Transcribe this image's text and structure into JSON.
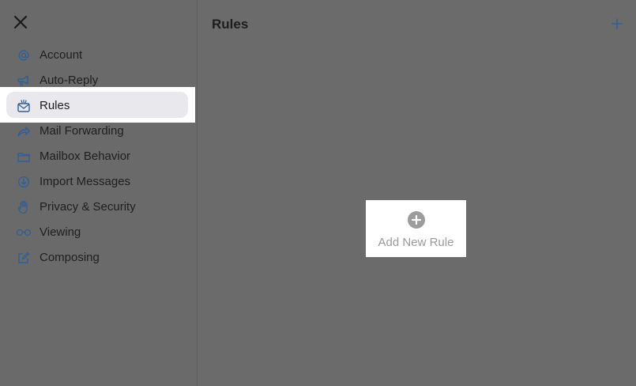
{
  "colors": {
    "accent": "#2f5f97",
    "sidebar_bg": "#6a6a6a",
    "overlay_bg": "#6b6b6b",
    "highlight": "#ffffff",
    "selected_pill": "#e8e8ed"
  },
  "sidebar": {
    "close_icon": "close-icon",
    "items": [
      {
        "label": "Account",
        "icon": "at-icon"
      },
      {
        "label": "Auto-Reply",
        "icon": "megaphone-icon"
      },
      {
        "label": "Rules",
        "icon": "rules-envelope-icon",
        "selected": true
      },
      {
        "label": "Mail Forwarding",
        "icon": "forward-arrow-icon"
      },
      {
        "label": "Mailbox Behavior",
        "icon": "folder-icon"
      },
      {
        "label": "Import Messages",
        "icon": "import-download-icon"
      },
      {
        "label": "Privacy & Security",
        "icon": "hand-icon"
      },
      {
        "label": "Viewing",
        "icon": "glasses-icon"
      },
      {
        "label": "Composing",
        "icon": "compose-icon"
      }
    ]
  },
  "main": {
    "title": "Rules",
    "add_icon": "plus-icon",
    "add_rule_label": "Add New Rule",
    "add_rule_icon": "plus-circle-icon"
  }
}
